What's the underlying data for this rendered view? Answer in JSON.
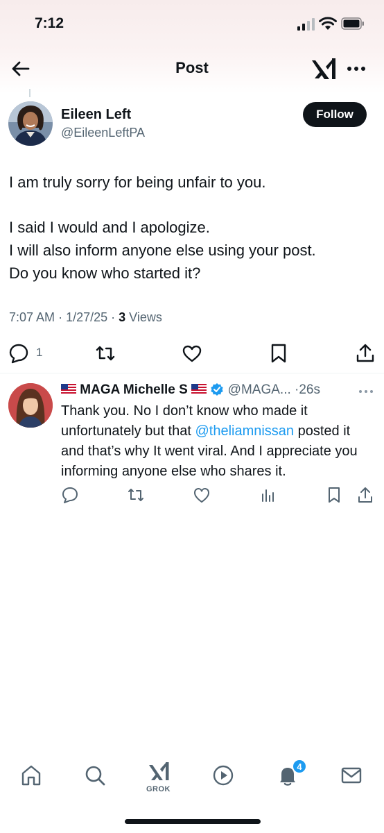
{
  "status_bar": {
    "time": "7:12"
  },
  "nav": {
    "title": "Post",
    "back_icon": "back-arrow-icon",
    "xai_icon": "xai-logo-icon",
    "more_icon": "more-icon"
  },
  "post": {
    "author_name": "Eileen Left",
    "author_handle": "@EileenLeftPA",
    "follow_label": "Follow",
    "text_lines": {
      "l1": "I am truly sorry for being unfair to you.",
      "l2": "I said I would and I apologize.",
      "l3": "I will also inform anyone else using your post.",
      "l4": "Do you know who started it?"
    },
    "time": "7:07 AM",
    "date": "1/27/25",
    "views_count": "3",
    "views_label": "Views",
    "reply_count": "1"
  },
  "reply": {
    "name": "MAGA Michelle S",
    "handle": "@MAGA...",
    "time": "26s",
    "text_before": "Thank you. No I don’t know who made it unfortunately but that ",
    "mention": "@theliamnissan",
    "text_after": " posted it and that’s why It went viral. And I appreciate you informing anyone else who shares it."
  },
  "tabbar": {
    "grok_label": "GROK",
    "notifications_badge": "4"
  },
  "colors": {
    "accent": "#1d9bf0",
    "text": "#0f1419",
    "muted": "#536471"
  }
}
